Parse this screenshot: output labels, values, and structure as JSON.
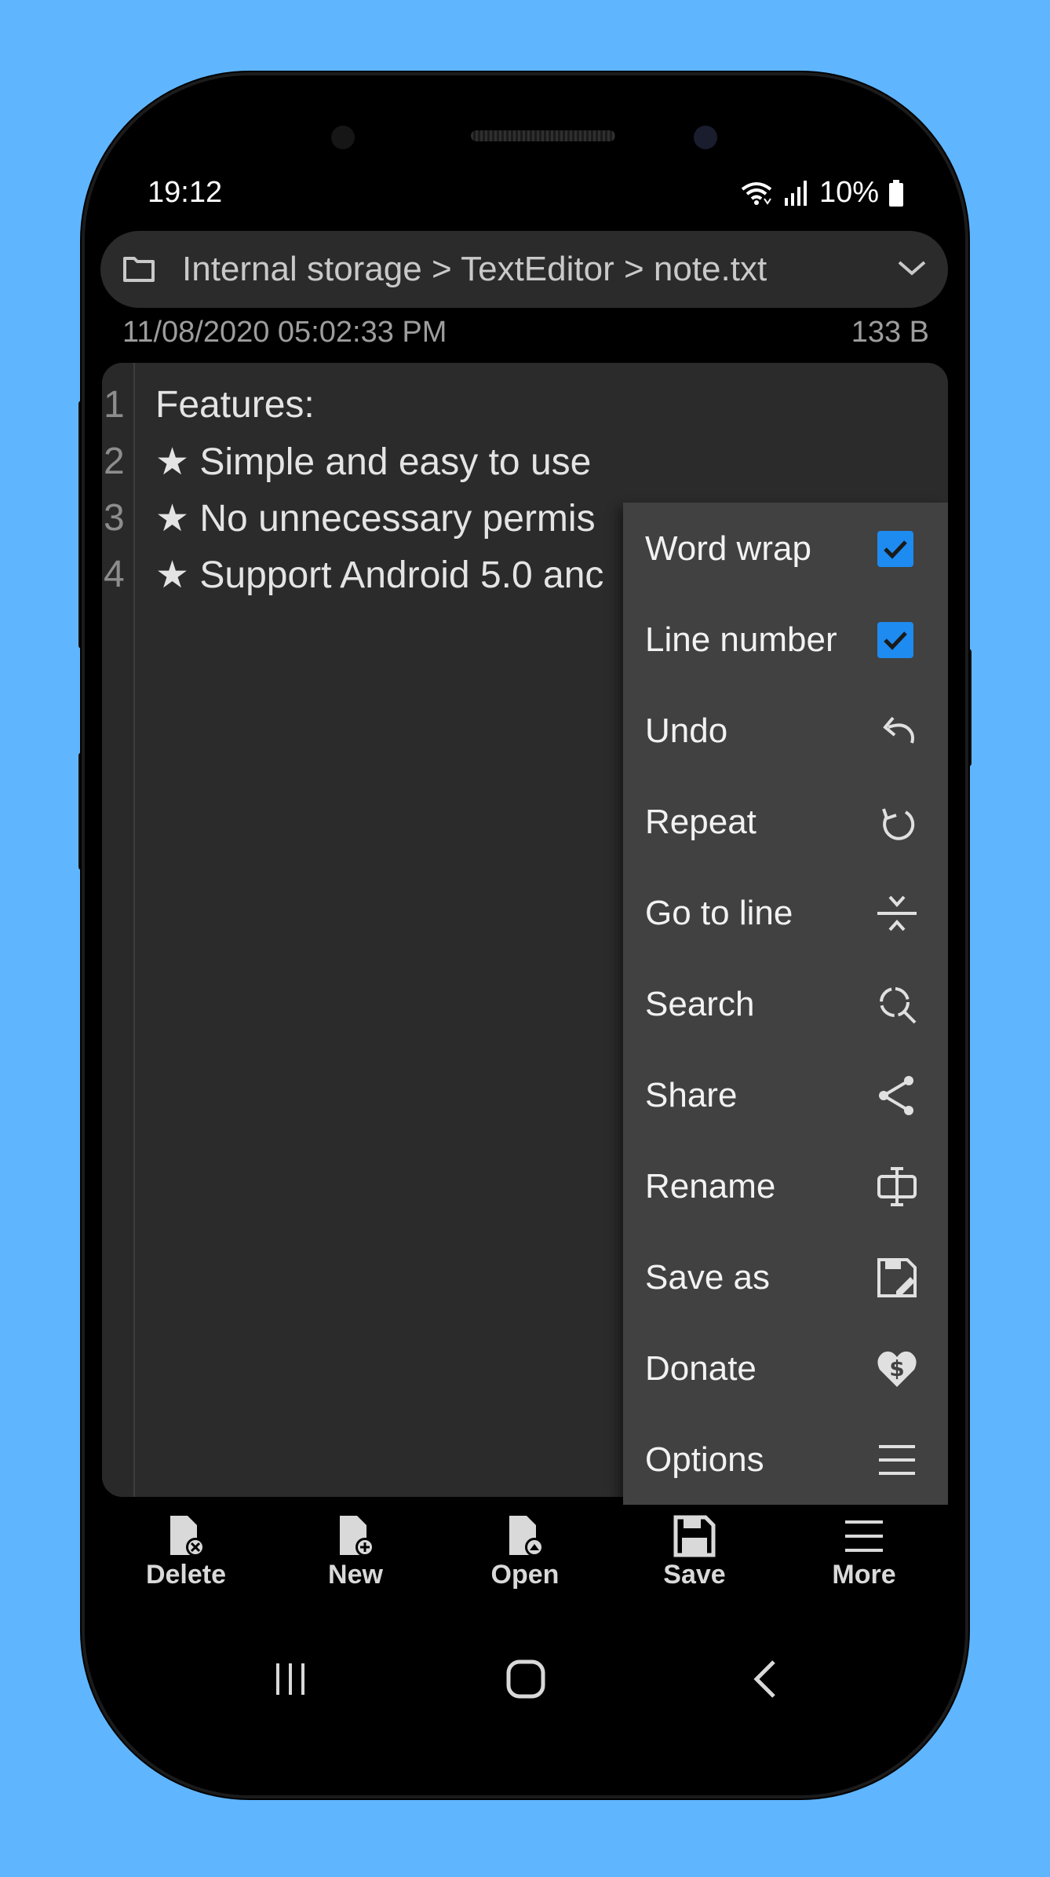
{
  "status_bar": {
    "time": "19:12",
    "battery": "10%"
  },
  "path_bar": {
    "breadcrumb": "Internal storage > TextEditor > note.txt",
    "icons": [
      "folder-icon",
      "chevron-down-icon"
    ]
  },
  "file_info": {
    "modified": "11/08/2020 05:02:33 PM",
    "size": "133 B"
  },
  "editor": {
    "line_numbers": [
      "1",
      "2",
      "3",
      "4"
    ],
    "lines": [
      "Features:",
      "★ Simple and easy to use",
      "★ No unnecessary permis",
      "★ Support Android 5.0 anc"
    ]
  },
  "overflow_menu": {
    "items": [
      {
        "label": "Word wrap",
        "checked": true
      },
      {
        "label": "Line number",
        "checked": true
      },
      {
        "label": "Undo",
        "icon": "undo-icon"
      },
      {
        "label": "Repeat",
        "icon": "redo-icon"
      },
      {
        "label": "Go to line",
        "icon": "go-to-line-icon"
      },
      {
        "label": "Search",
        "icon": "search-icon"
      },
      {
        "label": "Share",
        "icon": "share-icon"
      },
      {
        "label": "Rename",
        "icon": "rename-icon"
      },
      {
        "label": "Save as",
        "icon": "save-as-icon"
      },
      {
        "label": "Donate",
        "icon": "donate-heart-icon"
      },
      {
        "label": "Options",
        "icon": "options-menu-icon"
      }
    ]
  },
  "bottom_nav": {
    "items": [
      {
        "label": "Delete",
        "icon": "file-delete-icon"
      },
      {
        "label": "New",
        "icon": "file-new-icon"
      },
      {
        "label": "Open",
        "icon": "file-open-icon"
      },
      {
        "label": "Save",
        "icon": "floppy-save-icon"
      },
      {
        "label": "More",
        "icon": "hamburger-icon"
      }
    ]
  },
  "system_nav": [
    "recents-icon",
    "home-icon",
    "back-icon"
  ],
  "colors": {
    "background": "#5fb6ff",
    "checkbox": "#1e8bf0",
    "menu": "#414141",
    "editor": "#2b2b2b"
  }
}
